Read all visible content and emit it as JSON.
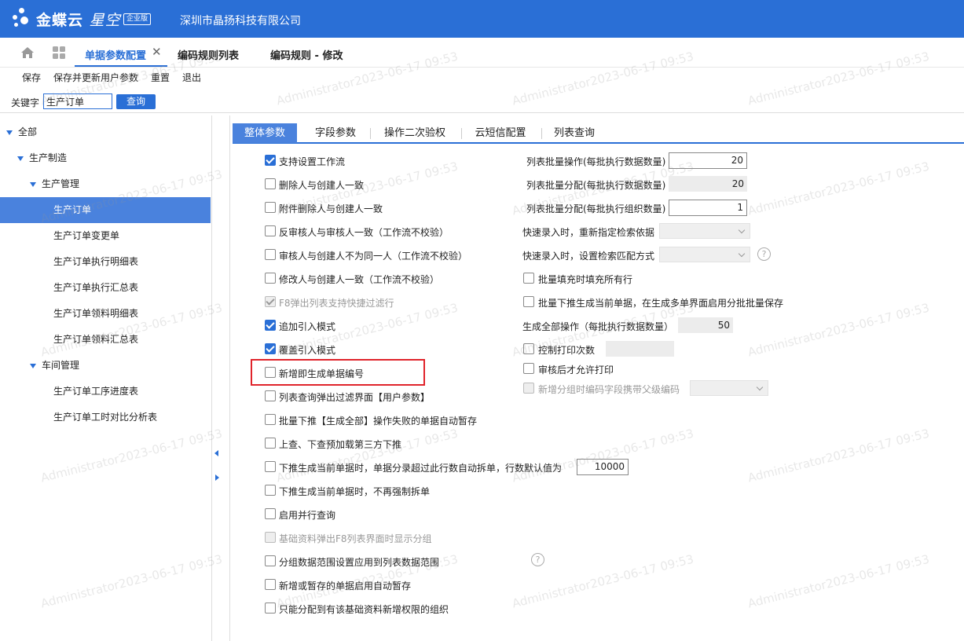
{
  "header": {
    "brand_bold": "金蝶云",
    "brand_light": "星空",
    "edition_badge": "企业版",
    "company": "深圳市晶扬科技有限公司"
  },
  "tabs": [
    {
      "label": "单据参数配置",
      "active": true
    },
    {
      "label": "编码规则列表",
      "active": false
    },
    {
      "label": "编码规则 - 修改",
      "active": false
    }
  ],
  "toolbar": [
    "保存",
    "保存并更新用户参数",
    "重置",
    "退出"
  ],
  "search": {
    "label": "关键字",
    "value": "生产订单",
    "button": "查询"
  },
  "tree": [
    {
      "label": "全部",
      "level": 0,
      "expanded": true,
      "selected": false
    },
    {
      "label": "生产制造",
      "level": 1,
      "expanded": true,
      "selected": false
    },
    {
      "label": "生产管理",
      "level": 2,
      "expanded": true,
      "selected": false
    },
    {
      "label": "生产订单",
      "level": 3,
      "expanded": false,
      "selected": true
    },
    {
      "label": "生产订单变更单",
      "level": 3,
      "expanded": false,
      "selected": false
    },
    {
      "label": "生产订单执行明细表",
      "level": 3,
      "expanded": false,
      "selected": false
    },
    {
      "label": "生产订单执行汇总表",
      "level": 3,
      "expanded": false,
      "selected": false
    },
    {
      "label": "生产订单领料明细表",
      "level": 3,
      "expanded": false,
      "selected": false
    },
    {
      "label": "生产订单领料汇总表",
      "level": 3,
      "expanded": false,
      "selected": false
    },
    {
      "label": "车间管理",
      "level": 2,
      "expanded": true,
      "selected": false
    },
    {
      "label": "生产订单工序进度表",
      "level": 3,
      "expanded": false,
      "selected": false
    },
    {
      "label": "生产订单工时对比分析表",
      "level": 3,
      "expanded": false,
      "selected": false
    }
  ],
  "sub_tabs": [
    {
      "label": "整体参数",
      "active": true
    },
    {
      "label": "字段参数",
      "active": false
    },
    {
      "label": "操作二次验权",
      "active": false
    },
    {
      "label": "云短信配置",
      "active": false
    },
    {
      "label": "列表查询",
      "active": false
    }
  ],
  "left_options": [
    {
      "label": "支持设置工作流",
      "checked": true,
      "disabled": false
    },
    {
      "label": "删除人与创建人一致",
      "checked": false,
      "disabled": false
    },
    {
      "label": "附件删除人与创建人一致",
      "checked": false,
      "disabled": false
    },
    {
      "label": "反审核人与审核人一致（工作流不校验）",
      "checked": false,
      "disabled": false
    },
    {
      "label": "审核人与创建人不为同一人（工作流不校验）",
      "checked": false,
      "disabled": false
    },
    {
      "label": "修改人与创建人一致（工作流不校验）",
      "checked": false,
      "disabled": false
    },
    {
      "label": "F8弹出列表支持快捷过滤行",
      "checked": true,
      "disabled": true
    },
    {
      "label": "追加引入模式",
      "checked": true,
      "disabled": false
    },
    {
      "label": "覆盖引入模式",
      "checked": true,
      "disabled": false
    },
    {
      "label": "新增即生成单据编号",
      "checked": false,
      "disabled": false
    },
    {
      "label": "列表查询弹出过滤界面【用户参数】",
      "checked": false,
      "disabled": false
    },
    {
      "label": "批量下推【生成全部】操作失败的单据自动暂存",
      "checked": false,
      "disabled": false
    },
    {
      "label": "上查、下查预加载第三方下推",
      "checked": false,
      "disabled": false
    },
    {
      "label": "下推生成当前单据时，单据分录超过此行数自动拆单，行数默认值为",
      "checked": false,
      "disabled": false
    },
    {
      "label": "下推生成当前单据时，不再强制拆单",
      "checked": false,
      "disabled": false
    },
    {
      "label": "启用并行查询",
      "checked": false,
      "disabled": false
    },
    {
      "label": "基础资料弹出F8列表界面时显示分组",
      "checked": false,
      "disabled": true
    },
    {
      "label": "分组数据范围设置应用到列表数据范围",
      "checked": false,
      "disabled": false
    },
    {
      "label": "新增或暂存的单据启用自动暂存",
      "checked": false,
      "disabled": false
    },
    {
      "label": "只能分配到有该基础资料新增权限的组织",
      "checked": false,
      "disabled": false
    }
  ],
  "split_rows_value": "10000",
  "right_fields": {
    "batch_op_label": "列表批量操作(每批执行数据数量)",
    "batch_op_value": "20",
    "batch_assign_label": "列表批量分配(每批执行数据数量)",
    "batch_assign_value": "20",
    "batch_assign_org_label": "列表批量分配(每批执行组织数量)",
    "batch_assign_org_value": "1",
    "quick_entry_reassign_label": "快速录入时，重新指定检索依据",
    "quick_entry_match_label": "快速录入时，设置检索匹配方式",
    "fill_all_rows_label": "批量填充时填充所有行",
    "push_save_label": "批量下推生成当前单据，在生成多单界面启用分批批量保存",
    "gen_all_label": "生成全部操作（每批执行数据数量）",
    "gen_all_value": "50",
    "print_count_label": "控制打印次数",
    "print_after_audit_label": "审核后才允许打印",
    "group_code_label": "新增分组时编码字段携带父级编码"
  },
  "watermark": "Administrator2023-06-17 09:53",
  "colors": {
    "header_bg": "#2a6fd6",
    "selected_bg": "#4a82dd",
    "highlight_box": "#e0242b"
  }
}
